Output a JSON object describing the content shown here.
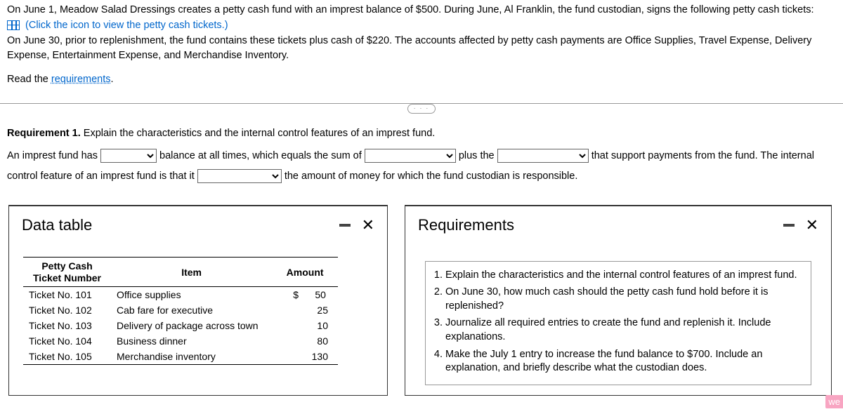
{
  "problem": {
    "p1": "On June 1, Meadow Salad Dressings creates a petty cash fund with an imprest balance of $500. During June, Al Franklin, the fund custodian, signs the following petty cash tickets:",
    "ticketsLinkText": "(Click the icon to view the petty cash tickets.)",
    "p2": "On June 30, prior to replenishment, the fund contains these tickets plus cash of $220. The accounts affected by petty cash payments are Office Supplies, Travel Expense, Delivery Expense, Entertainment Expense, and Merchandise Inventory.",
    "readText": "Read the ",
    "requirementsLink": "requirements"
  },
  "pill": "· · ·",
  "req1": {
    "heading": "Requirement 1.",
    "headingRest": " Explain the characteristics and the internal control features of an imprest fund.",
    "t1": "An imprest fund has ",
    "t2": " balance at all times, which equals the sum of ",
    "t3": " plus the ",
    "t4": " that support payments from the fund. The internal control feature of an imprest fund is that it ",
    "t5": " the amount of money for which the fund custodian is responsible."
  },
  "dataTable": {
    "title": "Data table",
    "headers": {
      "col1a": "Petty Cash",
      "col1b": "Ticket Number",
      "col2": "Item",
      "col3": "Amount"
    },
    "currency": "$",
    "rows": [
      {
        "num": "Ticket No. 101",
        "item": "Office supplies",
        "amt": "50"
      },
      {
        "num": "Ticket No. 102",
        "item": "Cab fare for executive",
        "amt": "25"
      },
      {
        "num": "Ticket No. 103",
        "item": "Delivery of package across town",
        "amt": "10"
      },
      {
        "num": "Ticket No. 104",
        "item": "Business dinner",
        "amt": "80"
      },
      {
        "num": "Ticket No. 105",
        "item": "Merchandise inventory",
        "amt": "130"
      }
    ]
  },
  "requirementsPopup": {
    "title": "Requirements",
    "items": [
      "Explain the characteristics and the internal control features of an imprest fund.",
      "On June 30, how much cash should the petty cash fund hold before it is replenished?",
      "Journalize all required entries to create the fund and replenish it. Include explanations.",
      "Make the July 1 entry to increase the fund balance to $700. Include an explanation, and briefly describe what the custodian does."
    ]
  },
  "badge": "we"
}
